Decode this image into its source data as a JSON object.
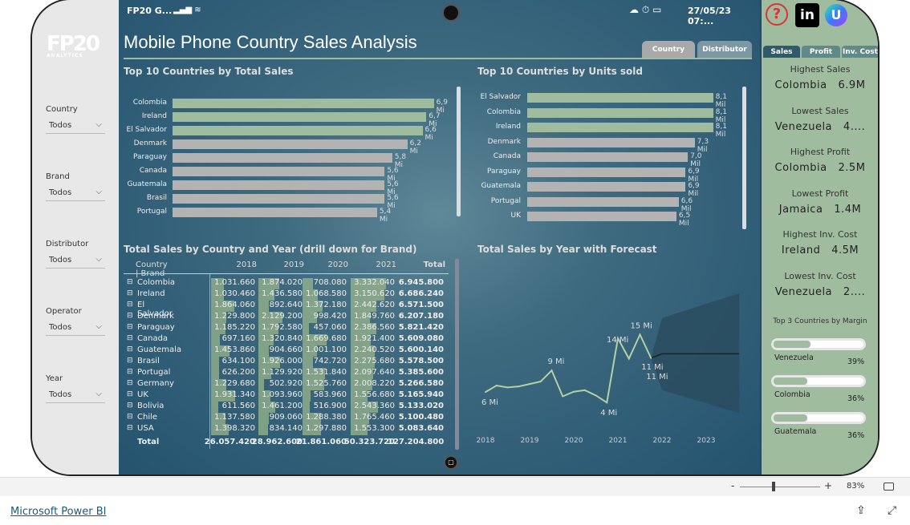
{
  "status": {
    "carrier": "FP20 G...",
    "datetime": "27/05/23 07:..."
  },
  "title": "Mobile Phone Country Sales Analysis",
  "brand": {
    "logo": "FP20",
    "logo_sub": "ANALYTICS"
  },
  "page_tabs": [
    {
      "label": "Country",
      "active": true
    },
    {
      "label": "Distributor",
      "active": false
    }
  ],
  "filters": [
    {
      "label": "Country",
      "value": "Todos"
    },
    {
      "label": "Brand",
      "value": "Todos"
    },
    {
      "label": "Distributor",
      "value": "Todos"
    },
    {
      "label": "Operator",
      "value": "Todos"
    },
    {
      "label": "Year",
      "value": "Todos"
    }
  ],
  "colors": {
    "highlight": "#9fbc9f",
    "bar": "#b3b3b3",
    "line": "#b5d0a5",
    "forecast_band": "#2a4a5c"
  },
  "chart_data": [
    {
      "type": "bar",
      "title": "Top 10 Countries by Total Sales",
      "categories": [
        "Colombia",
        "Ireland",
        "El Salvador",
        "Denmark",
        "Paraguay",
        "Canada",
        "Guatemala",
        "Brasil",
        "Portugal"
      ],
      "values": [
        6.9,
        6.7,
        6.6,
        6.2,
        5.8,
        5.6,
        5.6,
        5.6,
        5.4
      ],
      "labels": [
        "6,9 Mi",
        "6,7 Mi",
        "6,6 Mi",
        "6,2 Mi",
        "5,8 Mi",
        "5,6 Mi",
        "5,6 Mi",
        "5,6 Mi",
        "5,4 Mi"
      ],
      "highlighted": 3,
      "orientation": "horizontal"
    },
    {
      "type": "bar",
      "title": "Top 10 Countries by Units sold",
      "categories": [
        "El Salvador",
        "Colombia",
        "Ireland",
        "Denmark",
        "Canada",
        "Paraguay",
        "Guatemala",
        "Portugal",
        "UK"
      ],
      "values": [
        8.1,
        8.1,
        8.1,
        7.3,
        7.0,
        6.9,
        6.9,
        6.6,
        6.5
      ],
      "labels": [
        "8,1 Mil",
        "8,1 Mil",
        "8,1 Mil",
        "7,3 Mil",
        "7,0 Mil",
        "6,9 Mil",
        "6,9 Mil",
        "6,6 Mil",
        "6,5 Mil"
      ],
      "highlighted": 3,
      "orientation": "horizontal"
    },
    {
      "type": "line",
      "title": "Total Sales by Year with Forecast",
      "x_ticks": [
        "2018",
        "2019",
        "2020",
        "2021",
        "2022",
        "2023"
      ],
      "x": [
        2018,
        2018.25,
        2018.5,
        2018.75,
        2019,
        2019.25,
        2019.5,
        2019.75,
        2020,
        2020.25,
        2020.5,
        2020.75,
        2021,
        2021.25,
        2021.5,
        2021.75
      ],
      "y": [
        5.7,
        6.75,
        6.45,
        6.6,
        7.0,
        7.4,
        9.2,
        5.0,
        5.75,
        6.0,
        5.15,
        4.0,
        14.4,
        11.1,
        15.0,
        11.2
      ],
      "point_labels": [
        {
          "i": 0,
          "text": "6 Mi"
        },
        {
          "i": 6,
          "text": "9 Mi"
        },
        {
          "i": 11,
          "text": "4 Mi"
        },
        {
          "i": 12,
          "text": "14 Mi"
        },
        {
          "i": 14,
          "text": "15 Mi"
        },
        {
          "i": 15,
          "text": "11 Mi"
        }
      ],
      "forecast": {
        "x": [
          2021.75,
          2022,
          2023.75
        ],
        "y": [
          11.2,
          11.9,
          11.9
        ],
        "upper": [
          11.2,
          17.7,
          21.7
        ],
        "lower": [
          11.2,
          6.0,
          2.3
        ],
        "label": "11 Mi"
      }
    }
  ],
  "matrix": {
    "title": "Total Sales by Country and Year (drill down for Brand)",
    "headers": [
      "Country | Brand",
      "2018",
      "2019",
      "2020",
      "2021",
      "Total"
    ],
    "rows": [
      [
        "Colombia",
        "1.031.660",
        "1.874.020",
        "708.080",
        "3.332.040",
        "6.945.800"
      ],
      [
        "Ireland",
        "1.030.460",
        "1.436.580",
        "1.068.580",
        "3.150.620",
        "6.686.240"
      ],
      [
        "El Salvador",
        "1.864.060",
        "892.640",
        "1.372.180",
        "2.442.620",
        "6.571.500"
      ],
      [
        "Denmark",
        "1.229.800",
        "2.129.200",
        "998.420",
        "1.849.760",
        "6.207.180"
      ],
      [
        "Paraguay",
        "1.185.220",
        "1.792.580",
        "457.060",
        "2.386.560",
        "5.821.420"
      ],
      [
        "Canada",
        "697.160",
        "1.320.840",
        "1.669.680",
        "1.921.400",
        "5.609.080"
      ],
      [
        "Guatemala",
        "1.453.860",
        "904.660",
        "1.001.100",
        "2.240.520",
        "5.600.140"
      ],
      [
        "Brasil",
        "634.100",
        "1.926.000",
        "742.720",
        "2.275.680",
        "5.578.500"
      ],
      [
        "Portugal",
        "626.200",
        "1.129.920",
        "1.531.840",
        "2.097.640",
        "5.385.600"
      ],
      [
        "Germany",
        "1.229.680",
        "502.920",
        "1.525.760",
        "2.008.220",
        "5.266.580"
      ],
      [
        "UK",
        "1.931.340",
        "1.093.960",
        "583.960",
        "1.556.680",
        "5.165.940"
      ],
      [
        "Bolivia",
        "611.560",
        "1.461.200",
        "516.900",
        "2.543.360",
        "5.133.020"
      ],
      [
        "Chile",
        "1.137.580",
        "909.060",
        "1.288.380",
        "1.765.460",
        "5.100.480"
      ],
      [
        "USA",
        "1.398.320",
        "834.140",
        "1.297.880",
        "1.553.300",
        "5.083.640"
      ]
    ],
    "total": [
      "Total",
      "26.057.420",
      "28.962.600",
      "21.861.060",
      "50.323.720",
      "127.204.800"
    ]
  },
  "right": {
    "tabs": [
      {
        "label": "Sales",
        "active": true
      },
      {
        "label": "Profit"
      },
      {
        "label": "Inv. Cost"
      }
    ],
    "kpis": [
      {
        "title": "Highest Sales",
        "value": "Colombia   6.9M"
      },
      {
        "title": "Lowest Sales",
        "value": "Venezuela   4...."
      },
      {
        "title": "Highest Profit",
        "value": "Colombia   2.5M"
      },
      {
        "title": "Lowest Profit",
        "value": "Jamaica   1.4M"
      },
      {
        "title": "Highest Inv. Cost",
        "value": "Ireland   4.5M"
      },
      {
        "title": "Lowest Inv. Cost",
        "value": "Venezuela   2...."
      }
    ],
    "margin_title": "Top 3 Countries by Margin",
    "margins": [
      {
        "country": "Venezuela",
        "label": "39%",
        "value": 39
      },
      {
        "country": "Colombia",
        "label": "36%",
        "value": 36
      },
      {
        "country": "Guatemala",
        "label": "36%",
        "value": 36
      }
    ]
  },
  "bottom": {
    "zoom_minus": "-",
    "zoom_plus": "+",
    "zoom": "83%",
    "zoom_level": 83
  },
  "footer": {
    "link": "Microsoft Power BI"
  }
}
